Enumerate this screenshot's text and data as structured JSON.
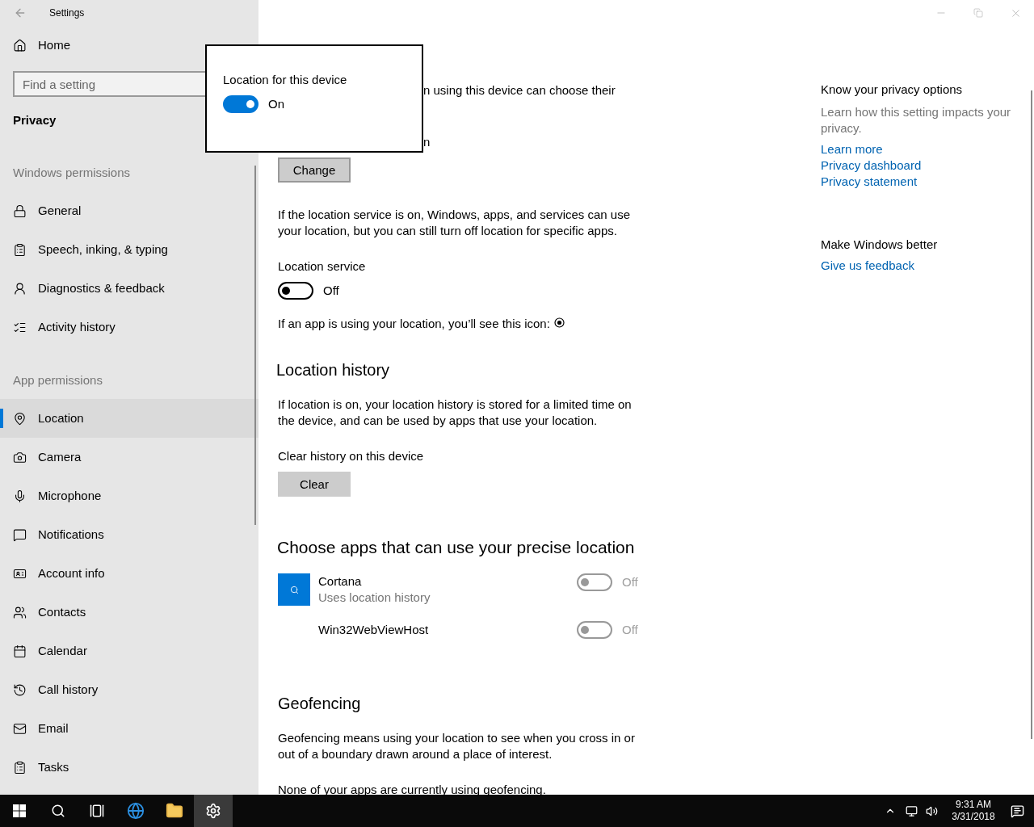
{
  "window": {
    "title": "Settings"
  },
  "sidebar": {
    "home": "Home",
    "search": {
      "placeholder": "Find a setting"
    },
    "heading": "Privacy",
    "sections": [
      {
        "title": "Windows permissions",
        "items": [
          {
            "label": "General",
            "kind": "lock",
            "selected": false
          },
          {
            "label": "Speech, inking, & typing",
            "kind": "clipboard",
            "selected": false
          },
          {
            "label": "Diagnostics & feedback",
            "kind": "person",
            "selected": false
          },
          {
            "label": "Activity history",
            "kind": "list",
            "selected": false
          }
        ]
      },
      {
        "title": "App permissions",
        "items": [
          {
            "label": "Location",
            "kind": "pin",
            "selected": true
          },
          {
            "label": "Camera",
            "kind": "camera",
            "selected": false
          },
          {
            "label": "Microphone",
            "kind": "mic",
            "selected": false
          },
          {
            "label": "Notifications",
            "kind": "bubble",
            "selected": false
          },
          {
            "label": "Account info",
            "kind": "idcard",
            "selected": false
          },
          {
            "label": "Contacts",
            "kind": "people",
            "selected": false
          },
          {
            "label": "Calendar",
            "kind": "calendar",
            "selected": false
          },
          {
            "label": "Call history",
            "kind": "history",
            "selected": false
          },
          {
            "label": "Email",
            "kind": "mail",
            "selected": false
          },
          {
            "label": "Tasks",
            "kind": "clipboard",
            "selected": false
          }
        ]
      }
    ]
  },
  "popup": {
    "title": "Location for this device",
    "on": true,
    "state_label": "On"
  },
  "content": {
    "covered_lines": [
      "n using this device can choose their",
      "n"
    ],
    "change_button": "Change",
    "service_note": "If the location service is on, Windows, apps, and services can use your location, but you can still turn off location for specific apps.",
    "location_service": {
      "label": "Location service",
      "on": false,
      "state_label": "Off"
    },
    "icon_note": "If an app is using your location, you’ll see this icon:",
    "history": {
      "heading": "Location history",
      "text": "If location is on, your location history is stored for a limited time on the device, and can be used by apps that use your location.",
      "clear_label": "Clear history on this device",
      "clear_button": "Clear"
    },
    "apps": {
      "heading": "Choose apps that can use your precise location",
      "items": [
        {
          "name": "Cortana",
          "subtitle": "Uses location history",
          "kind": "tile",
          "on": false,
          "disabled": true,
          "state_label": "Off"
        },
        {
          "name": "Win32WebViewHost",
          "kind": "blank",
          "on": false,
          "disabled": true,
          "state_label": "Off"
        }
      ]
    },
    "geofencing": {
      "heading": "Geofencing",
      "text": "Geofencing means using your location to see when you cross in or out of a boundary drawn around a place of interest.",
      "note": "None of your apps are currently using geofencing."
    }
  },
  "aside": {
    "sections": [
      {
        "heading": "Know your privacy options",
        "text": "Learn how this setting impacts your privacy.",
        "links": [
          "Learn more",
          "Privacy dashboard",
          "Privacy statement"
        ]
      },
      {
        "heading": "Make Windows better",
        "links": [
          "Give us feedback"
        ]
      }
    ]
  },
  "taskbar": {
    "apps": [
      {
        "kind": "start",
        "selected": false
      },
      {
        "kind": "search",
        "selected": false
      },
      {
        "kind": "taskview",
        "selected": false
      },
      {
        "kind": "browser",
        "selected": false
      },
      {
        "kind": "folder",
        "selected": false
      },
      {
        "kind": "settings",
        "selected": true
      }
    ],
    "clock": {
      "time": "9:31 AM",
      "date": "3/31/2018"
    }
  }
}
